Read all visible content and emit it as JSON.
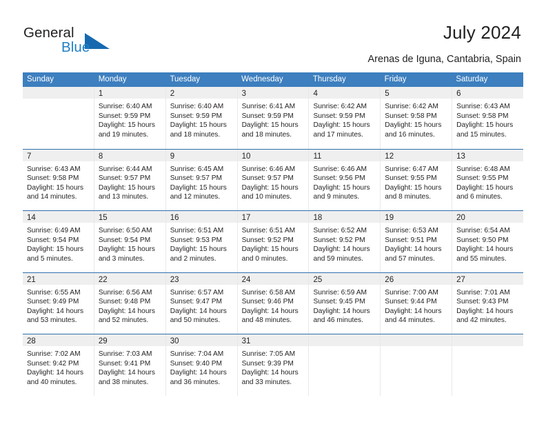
{
  "brand": {
    "name_part1": "General",
    "name_part2": "Blue",
    "accent_color": "#1669b0",
    "text_color": "#231f20"
  },
  "header": {
    "title": "July 2024",
    "subtitle": "Arenas de Iguna, Cantabria, Spain"
  },
  "theme": {
    "header_row_bg": "#3d7fbf",
    "row_divider": "#2f6fad",
    "day_band_bg": "#efefef"
  },
  "weekdays": [
    "Sunday",
    "Monday",
    "Tuesday",
    "Wednesday",
    "Thursday",
    "Friday",
    "Saturday"
  ],
  "weeks": [
    [
      {
        "day": "",
        "lines": []
      },
      {
        "day": "1",
        "lines": [
          "Sunrise: 6:40 AM",
          "Sunset: 9:59 PM",
          "Daylight: 15 hours",
          "and 19 minutes."
        ]
      },
      {
        "day": "2",
        "lines": [
          "Sunrise: 6:40 AM",
          "Sunset: 9:59 PM",
          "Daylight: 15 hours",
          "and 18 minutes."
        ]
      },
      {
        "day": "3",
        "lines": [
          "Sunrise: 6:41 AM",
          "Sunset: 9:59 PM",
          "Daylight: 15 hours",
          "and 18 minutes."
        ]
      },
      {
        "day": "4",
        "lines": [
          "Sunrise: 6:42 AM",
          "Sunset: 9:59 PM",
          "Daylight: 15 hours",
          "and 17 minutes."
        ]
      },
      {
        "day": "5",
        "lines": [
          "Sunrise: 6:42 AM",
          "Sunset: 9:58 PM",
          "Daylight: 15 hours",
          "and 16 minutes."
        ]
      },
      {
        "day": "6",
        "lines": [
          "Sunrise: 6:43 AM",
          "Sunset: 9:58 PM",
          "Daylight: 15 hours",
          "and 15 minutes."
        ]
      }
    ],
    [
      {
        "day": "7",
        "lines": [
          "Sunrise: 6:43 AM",
          "Sunset: 9:58 PM",
          "Daylight: 15 hours",
          "and 14 minutes."
        ]
      },
      {
        "day": "8",
        "lines": [
          "Sunrise: 6:44 AM",
          "Sunset: 9:57 PM",
          "Daylight: 15 hours",
          "and 13 minutes."
        ]
      },
      {
        "day": "9",
        "lines": [
          "Sunrise: 6:45 AM",
          "Sunset: 9:57 PM",
          "Daylight: 15 hours",
          "and 12 minutes."
        ]
      },
      {
        "day": "10",
        "lines": [
          "Sunrise: 6:46 AM",
          "Sunset: 9:57 PM",
          "Daylight: 15 hours",
          "and 10 minutes."
        ]
      },
      {
        "day": "11",
        "lines": [
          "Sunrise: 6:46 AM",
          "Sunset: 9:56 PM",
          "Daylight: 15 hours",
          "and 9 minutes."
        ]
      },
      {
        "day": "12",
        "lines": [
          "Sunrise: 6:47 AM",
          "Sunset: 9:55 PM",
          "Daylight: 15 hours",
          "and 8 minutes."
        ]
      },
      {
        "day": "13",
        "lines": [
          "Sunrise: 6:48 AM",
          "Sunset: 9:55 PM",
          "Daylight: 15 hours",
          "and 6 minutes."
        ]
      }
    ],
    [
      {
        "day": "14",
        "lines": [
          "Sunrise: 6:49 AM",
          "Sunset: 9:54 PM",
          "Daylight: 15 hours",
          "and 5 minutes."
        ]
      },
      {
        "day": "15",
        "lines": [
          "Sunrise: 6:50 AM",
          "Sunset: 9:54 PM",
          "Daylight: 15 hours",
          "and 3 minutes."
        ]
      },
      {
        "day": "16",
        "lines": [
          "Sunrise: 6:51 AM",
          "Sunset: 9:53 PM",
          "Daylight: 15 hours",
          "and 2 minutes."
        ]
      },
      {
        "day": "17",
        "lines": [
          "Sunrise: 6:51 AM",
          "Sunset: 9:52 PM",
          "Daylight: 15 hours",
          "and 0 minutes."
        ]
      },
      {
        "day": "18",
        "lines": [
          "Sunrise: 6:52 AM",
          "Sunset: 9:52 PM",
          "Daylight: 14 hours",
          "and 59 minutes."
        ]
      },
      {
        "day": "19",
        "lines": [
          "Sunrise: 6:53 AM",
          "Sunset: 9:51 PM",
          "Daylight: 14 hours",
          "and 57 minutes."
        ]
      },
      {
        "day": "20",
        "lines": [
          "Sunrise: 6:54 AM",
          "Sunset: 9:50 PM",
          "Daylight: 14 hours",
          "and 55 minutes."
        ]
      }
    ],
    [
      {
        "day": "21",
        "lines": [
          "Sunrise: 6:55 AM",
          "Sunset: 9:49 PM",
          "Daylight: 14 hours",
          "and 53 minutes."
        ]
      },
      {
        "day": "22",
        "lines": [
          "Sunrise: 6:56 AM",
          "Sunset: 9:48 PM",
          "Daylight: 14 hours",
          "and 52 minutes."
        ]
      },
      {
        "day": "23",
        "lines": [
          "Sunrise: 6:57 AM",
          "Sunset: 9:47 PM",
          "Daylight: 14 hours",
          "and 50 minutes."
        ]
      },
      {
        "day": "24",
        "lines": [
          "Sunrise: 6:58 AM",
          "Sunset: 9:46 PM",
          "Daylight: 14 hours",
          "and 48 minutes."
        ]
      },
      {
        "day": "25",
        "lines": [
          "Sunrise: 6:59 AM",
          "Sunset: 9:45 PM",
          "Daylight: 14 hours",
          "and 46 minutes."
        ]
      },
      {
        "day": "26",
        "lines": [
          "Sunrise: 7:00 AM",
          "Sunset: 9:44 PM",
          "Daylight: 14 hours",
          "and 44 minutes."
        ]
      },
      {
        "day": "27",
        "lines": [
          "Sunrise: 7:01 AM",
          "Sunset: 9:43 PM",
          "Daylight: 14 hours",
          "and 42 minutes."
        ]
      }
    ],
    [
      {
        "day": "28",
        "lines": [
          "Sunrise: 7:02 AM",
          "Sunset: 9:42 PM",
          "Daylight: 14 hours",
          "and 40 minutes."
        ]
      },
      {
        "day": "29",
        "lines": [
          "Sunrise: 7:03 AM",
          "Sunset: 9:41 PM",
          "Daylight: 14 hours",
          "and 38 minutes."
        ]
      },
      {
        "day": "30",
        "lines": [
          "Sunrise: 7:04 AM",
          "Sunset: 9:40 PM",
          "Daylight: 14 hours",
          "and 36 minutes."
        ]
      },
      {
        "day": "31",
        "lines": [
          "Sunrise: 7:05 AM",
          "Sunset: 9:39 PM",
          "Daylight: 14 hours",
          "and 33 minutes."
        ]
      },
      {
        "day": "",
        "lines": []
      },
      {
        "day": "",
        "lines": []
      },
      {
        "day": "",
        "lines": []
      }
    ]
  ]
}
